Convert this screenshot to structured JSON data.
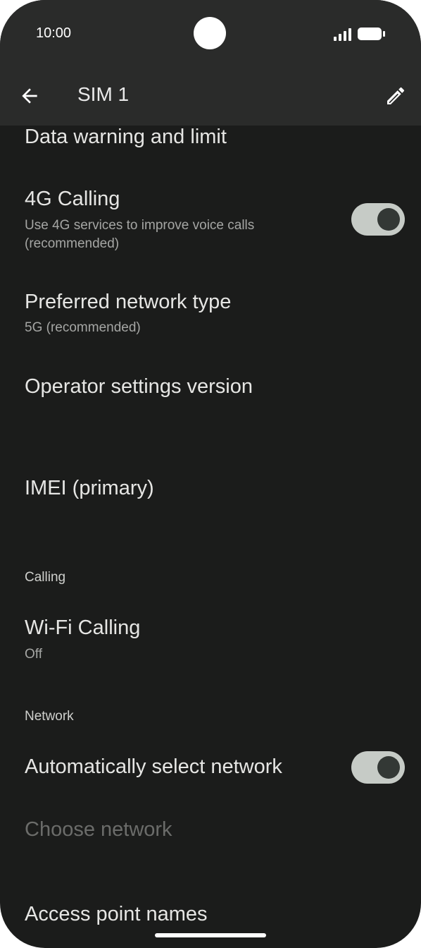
{
  "status_bar": {
    "time": "10:00"
  },
  "app_bar": {
    "title": "SIM 1",
    "back_icon": "arrow-back-icon",
    "edit_icon": "pencil-icon"
  },
  "items": {
    "data_warning": {
      "title": "Data warning and limit"
    },
    "calling_4g": {
      "title": "4G Calling",
      "subtitle": "Use 4G services to improve voice calls (recommended)",
      "toggle_on": true
    },
    "preferred_network": {
      "title": "Preferred network type",
      "subtitle": "5G (recommended)"
    },
    "operator_settings": {
      "title": "Operator settings version"
    },
    "imei": {
      "title": "IMEI (primary)"
    },
    "wifi_calling": {
      "title": "Wi-Fi Calling",
      "subtitle": "Off"
    },
    "auto_network": {
      "title": "Automatically select network",
      "toggle_on": true
    },
    "choose_network": {
      "title": "Choose network",
      "enabled": false
    },
    "apn": {
      "title": "Access point names"
    }
  },
  "sections": {
    "calling": "Calling",
    "network": "Network"
  },
  "colors": {
    "background": "#1b1c1b",
    "app_bar": "#2a2b2a",
    "toggle_track": "#c6cbc6",
    "toggle_knob": "#333835"
  }
}
